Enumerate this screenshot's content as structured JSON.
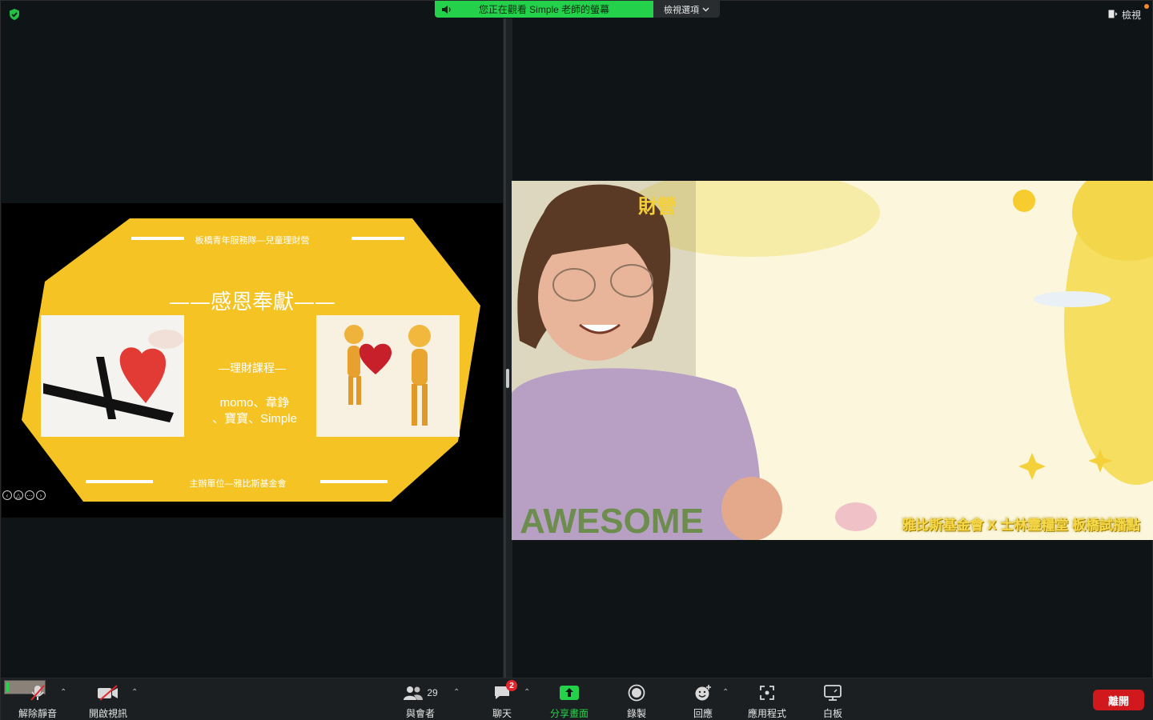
{
  "banner": {
    "sharing_text": "您正在觀看 Simple 老師的螢幕",
    "view_options": "檢視選項"
  },
  "top_right": {
    "view_label": "檢視"
  },
  "slide": {
    "header": "板橋青年服務隊—兒童理財營",
    "title": "——感恩奉獻——",
    "subtitle": "—理財課程—",
    "presenters_line1": "momo、韋錚",
    "presenters_line2": "、寶寶、Simple",
    "footer": "主辦單位—雅比斯基金會",
    "colors": {
      "shape": "#f5c323",
      "background": "#000000"
    }
  },
  "video": {
    "overlay_caption": "雅比斯基金會 X 士林靈糧堂 板橋試播點",
    "corner_text": "財營",
    "shirt_text": "AWESOME"
  },
  "toolbar": {
    "unmute": "解除靜音",
    "start_video": "開啟視訊",
    "participants": "與會者",
    "participants_count": "29",
    "chat": "聊天",
    "chat_badge": "2",
    "share_screen": "分享畫面",
    "record": "錄製",
    "reactions": "回應",
    "apps": "應用程式",
    "whiteboard": "白板",
    "leave": "離開"
  },
  "colors": {
    "accent_green": "#23d14b",
    "leave_red": "#d0181d",
    "toolbar_bg": "#1b1f21"
  }
}
